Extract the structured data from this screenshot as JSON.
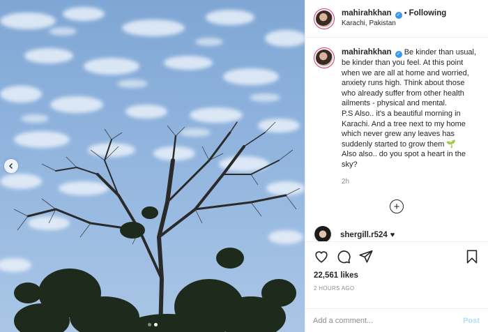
{
  "header": {
    "username": "mahirahkhan",
    "separator": "•",
    "follow_label": "Following",
    "location": "Karachi, Pakistan"
  },
  "caption": {
    "username": "mahirahkhan",
    "text": "Be kinder than usual, be kinder than you feel. At this point when we are all at home and worried, anxiety runs high. Think about those who already suffer from other health ailments - physical and mental.",
    "text2": "P.S Also.. it's a beautiful morning in Karachi. And a tree next to my home which never grew any leaves has suddenly started to grow them 🌱",
    "text3": "Also also.. do you spot a heart in the sky?",
    "time": "2h"
  },
  "comment": {
    "username": "shergill.r524",
    "emoji": "♥"
  },
  "actions": {
    "likes": "22,561 likes",
    "posted": "2 HOURS AGO"
  },
  "add_comment": {
    "placeholder": "Add a comment...",
    "post_label": "Post"
  },
  "icons": [
    "verified-badge",
    "chevron-left-icon",
    "plus-circle-icon",
    "heart-icon",
    "comment-icon",
    "share-icon",
    "bookmark-icon"
  ],
  "colors": {
    "verified": "#3897f0",
    "post_disabled": "#b2dffc",
    "sky": "#8fb3dc"
  }
}
